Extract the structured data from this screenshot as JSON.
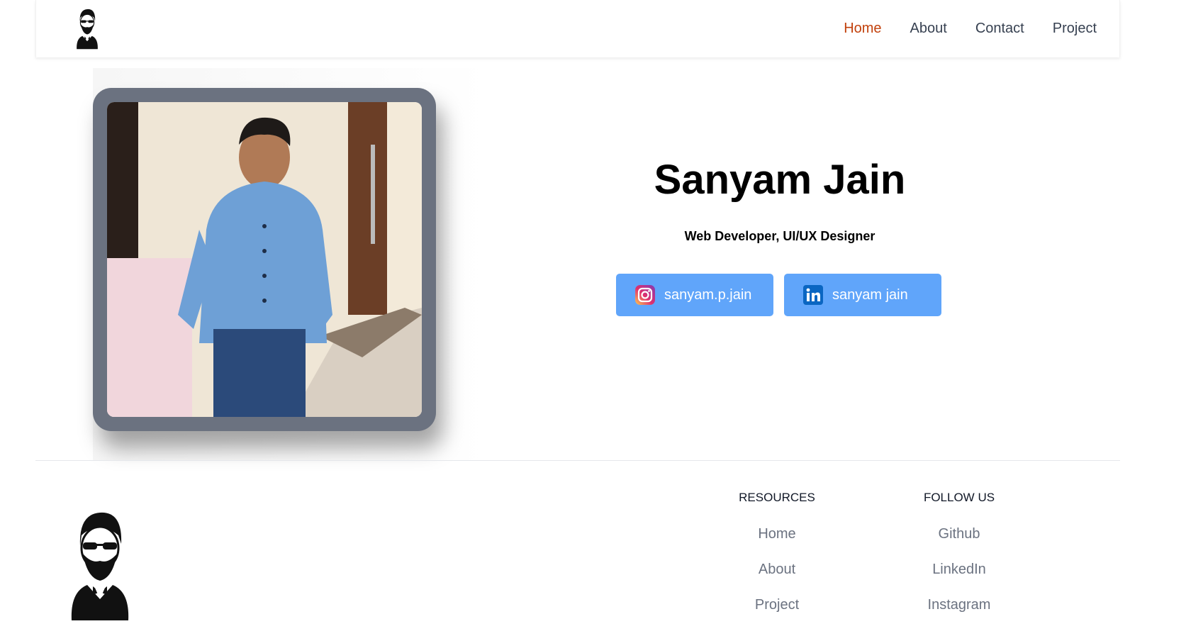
{
  "header": {
    "logo_icon": "bearded-man-logo-icon",
    "nav": [
      {
        "label": "Home",
        "active": true
      },
      {
        "label": "About",
        "active": false
      },
      {
        "label": "Contact",
        "active": false
      },
      {
        "label": "Project",
        "active": false
      }
    ]
  },
  "hero": {
    "photo_icon": "profile-photo",
    "name": "Sanyam Jain",
    "role": "Web Developer, UI/UX Designer",
    "socials": [
      {
        "icon": "instagram-icon",
        "label": "sanyam.p.jain"
      },
      {
        "icon": "linkedin-icon",
        "label": "sanyam jain"
      }
    ]
  },
  "footer": {
    "logo_icon": "bearded-man-logo-icon",
    "resources": {
      "title": "RESOURCES",
      "links": [
        "Home",
        "About",
        "Project"
      ]
    },
    "follow": {
      "title": "FOLLOW US",
      "links": [
        "Github",
        "LinkedIn",
        "Instagram"
      ]
    }
  },
  "colors": {
    "accent_nav": "#c2410c",
    "button_bg": "#60a5fa",
    "frame": "#6b7280",
    "footer_link": "#6b7280"
  }
}
